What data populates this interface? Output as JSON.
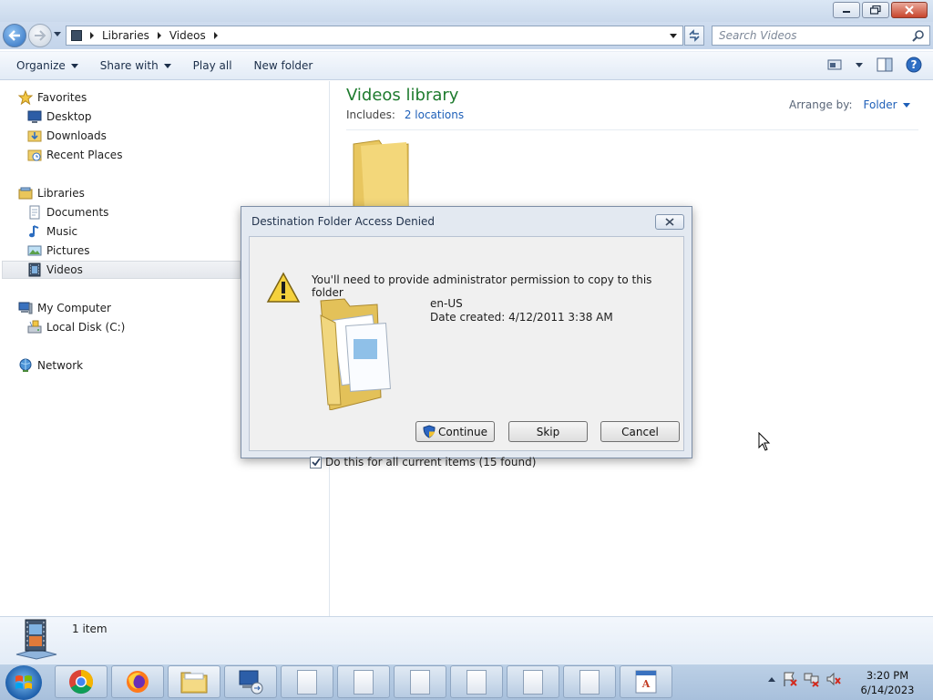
{
  "window": {
    "breadcrumbs": [
      "Libraries",
      "Videos"
    ],
    "search_placeholder": "Search Videos"
  },
  "commandbar": {
    "organize": "Organize",
    "share_with": "Share with",
    "play_all": "Play all",
    "new_folder": "New folder"
  },
  "navpane": {
    "favorites": "Favorites",
    "desktop": "Desktop",
    "downloads": "Downloads",
    "recent_places": "Recent Places",
    "libraries": "Libraries",
    "documents": "Documents",
    "music": "Music",
    "pictures": "Pictures",
    "videos": "Videos",
    "my_computer": "My Computer",
    "local_disk": "Local Disk (C:)",
    "network": "Network"
  },
  "content": {
    "title": "Videos library",
    "includes_label": "Includes:",
    "includes_link": "2 locations",
    "arrange_label": "Arrange by:",
    "arrange_value": "Folder"
  },
  "details": {
    "item_count": "1 item"
  },
  "dialog": {
    "title": "Destination Folder Access Denied",
    "message": "You'll need to provide administrator permission to copy to this folder",
    "file_name": "en-US",
    "file_date": "Date created: 4/12/2011 3:38 AM",
    "continue_label": "Continue",
    "skip_label": "Skip",
    "cancel_label": "Cancel",
    "checkbox_label": "Do this for all current items (15 found)",
    "checkbox_checked": true
  },
  "taskbar": {
    "time": "3:20 PM",
    "date": "6/14/2023"
  },
  "colors": {
    "library_title": "#1e7b2e",
    "link": "#1d5fb8"
  }
}
